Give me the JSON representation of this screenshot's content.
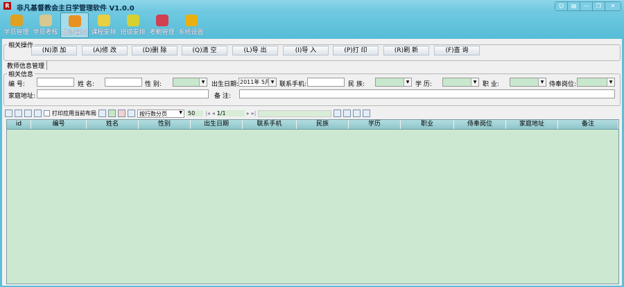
{
  "window": {
    "title": "非凡基督教会主日学管理软件 V1.0.0",
    "icon": "app-logo-icon",
    "controls": [
      "help",
      "skin",
      "—",
      "❐",
      "✕"
    ]
  },
  "nav": [
    {
      "label": "学员管理",
      "color": "#e0a020"
    },
    {
      "label": "学员考核",
      "color": "#d8c890"
    },
    {
      "label": "教师管理",
      "color": "#e89020",
      "active": true
    },
    {
      "label": "课程安排",
      "color": "#e8d040"
    },
    {
      "label": "班级安排",
      "color": "#d8d030"
    },
    {
      "label": "考勤管理",
      "color": "#d04050"
    },
    {
      "label": "系统设置",
      "color": "#e8b010"
    }
  ],
  "ops": {
    "legend": "相关操作",
    "buttons": [
      "(N)添 加",
      "(A)修 改",
      "(D)删 除",
      "(Q)清 空",
      "(L)导 出",
      "(I)导 入",
      "(P)打 印",
      "(R)刷 新",
      "(F)查 询"
    ]
  },
  "tab": "教师信息管理",
  "info": {
    "legend": "相关信息",
    "id": "编    号:",
    "name": "姓    名:",
    "gender": "性    别:",
    "birth": "出生日期:",
    "birth_value": "2011年 5月",
    "phone": "联系手机:",
    "ethnic": "民    族:",
    "edu": "学    历:",
    "job": "职    业:",
    "post": "侍奉岗位:",
    "address": "家庭地址:",
    "note": "备    注:"
  },
  "toolbar": {
    "print_layout": "打印应用当前布局",
    "paging": "按行数分页",
    "page_size": "50",
    "page": "1/1"
  },
  "grid": {
    "columns": [
      "id",
      "编号",
      "姓名",
      "性别",
      "出生日期",
      "联系手机",
      "民族",
      "学历",
      "职业",
      "侍奉岗位",
      "家庭地址",
      "备注"
    ]
  }
}
